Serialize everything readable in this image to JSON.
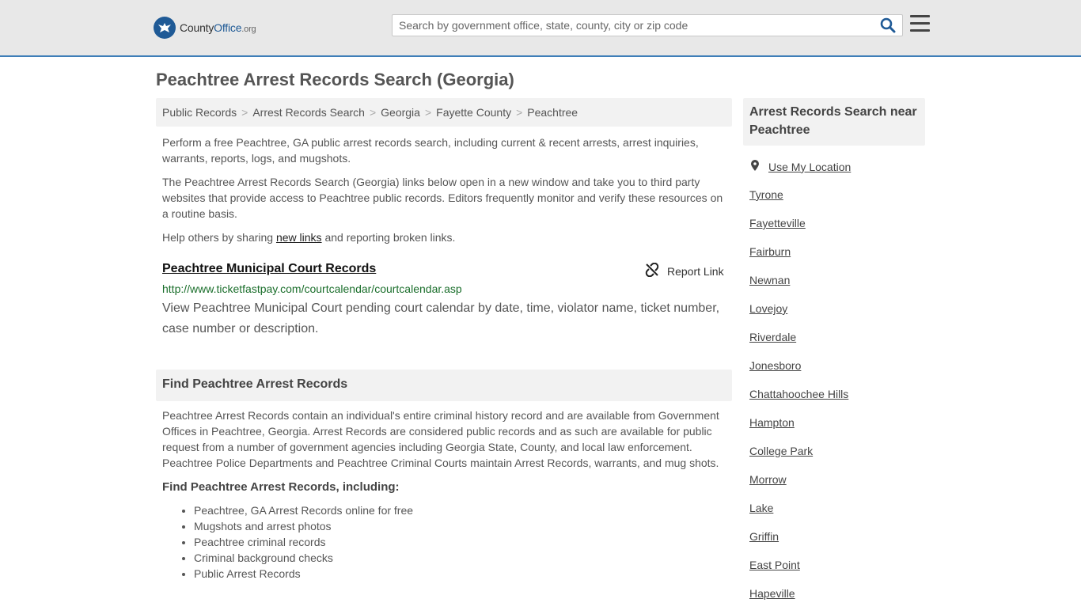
{
  "header": {
    "logo_main": "County",
    "logo_accent": "Office",
    "logo_tld": ".org",
    "search_placeholder": "Search by government office, state, county, city or zip code",
    "search_icon": "search-icon",
    "menu_icon": "hamburger-menu-icon",
    "accent_color": "#1f5a96"
  },
  "page": {
    "title": "Peachtree Arrest Records Search (Georgia)"
  },
  "breadcrumb": [
    "Public Records",
    "Arrest Records Search",
    "Georgia",
    "Fayette County",
    "Peachtree"
  ],
  "intro": {
    "p1": "Perform a free Peachtree, GA public arrest records search, including current & recent arrests, arrest inquiries, warrants, reports, logs, and mugshots.",
    "p2": "The Peachtree Arrest Records Search (Georgia) links below open in a new window and take you to third party websites that provide access to Peachtree public records. Editors frequently monitor and verify these resources on a routine basis.",
    "p3_before": "Help others by sharing ",
    "p3_link": "new links",
    "p3_after": " and reporting broken links."
  },
  "result": {
    "title": "Peachtree Municipal Court Records",
    "url": "http://www.ticketfastpay.com/courtcalendar/courtcalendar.asp",
    "description": "View Peachtree Municipal Court pending court calendar by date, time, violator name, ticket number, case number or description.",
    "report_label": "Report Link",
    "report_icon": "broken-link-icon"
  },
  "find_section": {
    "heading": "Find Peachtree Arrest Records",
    "paragraph": "Peachtree Arrest Records contain an individual's entire criminal history record and are available from Government Offices in Peachtree, Georgia. Arrest Records are considered public records and as such are available for public request from a number of government agencies including Georgia State, County, and local law enforcement. Peachtree Police Departments and Peachtree Criminal Courts maintain Arrest Records, warrants, and mug shots.",
    "subheading": "Find Peachtree Arrest Records, including:",
    "bullets": [
      "Peachtree, GA Arrest Records online for free",
      "Mugshots and arrest photos",
      "Peachtree criminal records",
      "Criminal background checks",
      "Public Arrest Records"
    ]
  },
  "sidebar": {
    "heading": "Arrest Records Search near Peachtree",
    "use_location": "Use My Location",
    "location_icon": "map-pin-icon",
    "cities": [
      "Tyrone",
      "Fayetteville",
      "Fairburn",
      "Newnan",
      "Lovejoy",
      "Riverdale",
      "Jonesboro",
      "Chattahoochee Hills",
      "Hampton",
      "College Park",
      "Morrow",
      "Lake",
      "Griffin",
      "East Point",
      "Hapeville"
    ]
  }
}
